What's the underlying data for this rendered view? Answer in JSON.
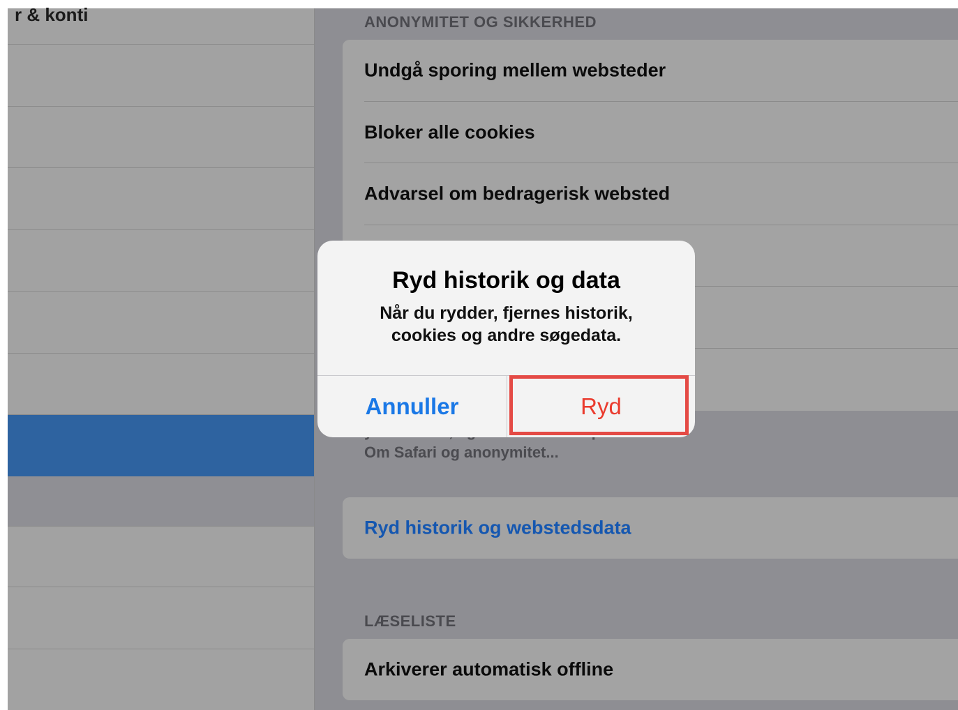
{
  "sidebar": {
    "top_label": "r & konti",
    "selected_index": 6
  },
  "privacy_section": {
    "header": "ANONYMITET OG SIKKERHED",
    "rows": [
      "Undgå sporing mellem websteder",
      "Bloker alle cookies",
      "Advarsel om bedragerisk websted"
    ],
    "footer_partial": "y er slået til, og om du har en Ap",
    "footer_link": "Om Safari og anonymitet..."
  },
  "clear_group": {
    "label": "Ryd historik og webstedsdata"
  },
  "reading_list": {
    "header": "LÆSELISTE",
    "row": "Arkiverer automatisk offline"
  },
  "alert": {
    "title": "Ryd historik og data",
    "message_line1": "Når du rydder, fjernes historik,",
    "message_line2": "cookies og andre søgedata.",
    "cancel_label": "Annuller",
    "confirm_label": "Ryd"
  },
  "colors": {
    "highlight": "#e44a45",
    "cancel": "#1a78e6",
    "destructive": "#ea3b2e",
    "selected_row": "#2e63a0"
  }
}
